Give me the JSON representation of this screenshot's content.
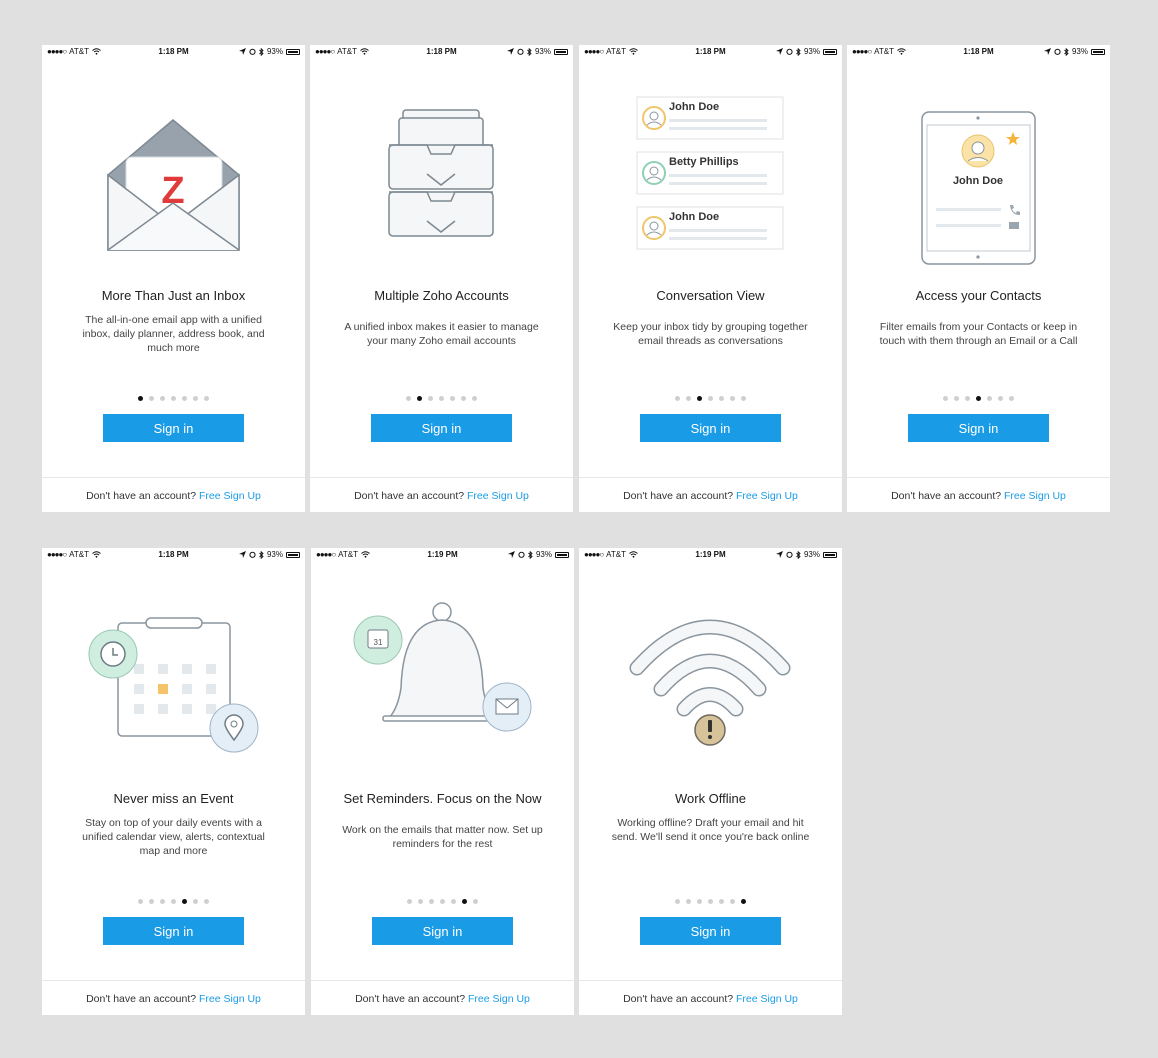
{
  "colors": {
    "accent": "#1a9be6",
    "background": "#e0e0e0"
  },
  "status_bar": {
    "carrier": "AT&T",
    "signal_dots": "●●●●○",
    "battery": "93%"
  },
  "sign_in_label": "Sign in",
  "footer": {
    "prompt": "Don't have an account?",
    "link": "Free Sign Up"
  },
  "screens": [
    {
      "time": "1:18 PM",
      "title": "More Than Just an Inbox",
      "description": "The all-in-one email app with a unified inbox, daily planner, address book, and much more",
      "active_page": 1,
      "illustration": "open-envelope-icon",
      "logo_letter": "Z"
    },
    {
      "time": "1:18 PM",
      "title": "Multiple Zoho Accounts",
      "description": "A unified inbox makes it easier to manage your many Zoho email accounts",
      "active_page": 2,
      "illustration": "stacked-inbox-trays-icon"
    },
    {
      "time": "1:18 PM",
      "title": "Conversation View",
      "description": "Keep your inbox tidy by grouping together email threads as conversations",
      "active_page": 3,
      "illustration": "conversation-cards-icon",
      "names": [
        "John Doe",
        "Betty Phillips",
        "John Doe"
      ]
    },
    {
      "time": "1:18 PM",
      "title": "Access your Contacts",
      "description": "Filter emails from your Contacts or keep in touch with them through an Email or a Call",
      "active_page": 4,
      "illustration": "tablet-contact-icon",
      "contact_name": "John Doe"
    },
    {
      "time": "1:18 PM",
      "title": "Never miss an Event",
      "description": "Stay on top of your daily events with a unified calendar view, alerts, contextual map and more",
      "active_page": 5,
      "illustration": "calendar-icon"
    },
    {
      "time": "1:19 PM",
      "title": "Set Reminders. Focus on the Now",
      "description": "Work on the emails that matter now. Set up reminders for the rest",
      "active_page": 6,
      "illustration": "bell-icon",
      "calendar_day": "31"
    },
    {
      "time": "1:19 PM",
      "title": "Work Offline",
      "description": "Working offline? Draft your email and hit send. We'll send it once you're back online",
      "active_page": 7,
      "illustration": "wifi-offline-icon"
    }
  ]
}
